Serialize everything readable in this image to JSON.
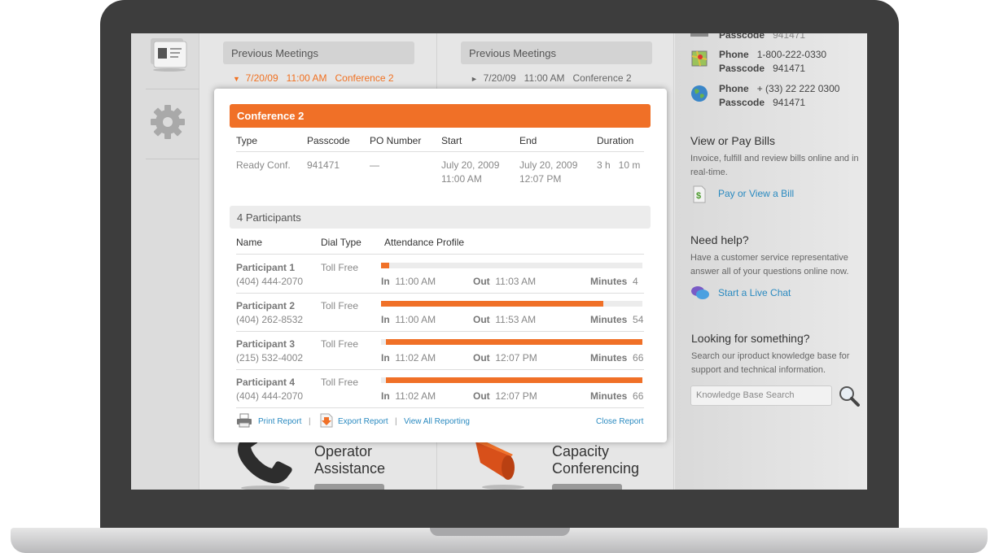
{
  "meetings": {
    "left": {
      "header": "Previous Meetings",
      "date": "7/20/09",
      "time": "11:00 AM",
      "name": "Conference 2",
      "arrow": "▼"
    },
    "right": {
      "header": "Previous Meetings",
      "date": "7/20/09",
      "time": "11:00 AM",
      "name": "Conference 2",
      "arrow": "►"
    }
  },
  "report": {
    "title": "Conference 2",
    "columns": [
      "Type",
      "Passcode",
      "PO Number",
      "Start",
      "End",
      "Duration"
    ],
    "type": "Ready Conf.",
    "passcode": "941471",
    "po_number": "—",
    "start_date": "July 20, 2009",
    "start_time": "11:00 AM",
    "end_date": "July 20, 2009",
    "end_time": "12:07 PM",
    "duration": "3 h   10 m",
    "participants_header": "4  Participants",
    "participant_columns": [
      "Name",
      "Dial Type",
      "Attendance Profile"
    ],
    "in_label": "In",
    "out_label": "Out",
    "minutes_label": "Minutes",
    "participants": [
      {
        "name": "Participant 1",
        "phone": "(404) 444-2070",
        "dial": "Toll Free",
        "in": "11:00 AM",
        "out": "11:03 AM",
        "minutes": "4",
        "bar_start": 0.0,
        "bar_end": 0.03
      },
      {
        "name": "Participant 2",
        "phone": "(404) 262-8532",
        "dial": "Toll Free",
        "in": "11:00 AM",
        "out": "11:53 AM",
        "minutes": "54",
        "bar_start": 0.0,
        "bar_end": 0.85
      },
      {
        "name": "Participant 3",
        "phone": "(215) 532-4002",
        "dial": "Toll Free",
        "in": "11:02 AM",
        "out": "12:07 PM",
        "minutes": "66",
        "bar_start": 0.02,
        "bar_end": 1.0
      },
      {
        "name": "Participant 4",
        "phone": "(404) 444-2070",
        "dial": "Toll Free",
        "in": "11:02 AM",
        "out": "12:07 PM",
        "minutes": "66",
        "bar_start": 0.02,
        "bar_end": 1.0
      }
    ],
    "footer": {
      "print": "Print Report",
      "export": "Export Report",
      "view_all": "View All Reporting",
      "close": "Close Report",
      "sep": "|"
    }
  },
  "right_pane": {
    "top_partial_label": "Passcode",
    "top_partial_value": "941471",
    "phone1_label": "Phone",
    "phone1_value": "1-800-222-0330",
    "pass1_label": "Passcode",
    "pass1_value": "941471",
    "phone2_label": "Phone",
    "phone2_value": "+ (33) 22 222 0300",
    "pass2_label": "Passcode",
    "pass2_value": "941471",
    "bills_title": "View or Pay Bills",
    "bills_text": "Invoice, fulfill and review bills online and in real-time.",
    "bills_link": "Pay or View a Bill",
    "help_title": "Need help?",
    "help_text": "Have a customer service representative answer all of your questions online now.",
    "help_link": "Start a Live Chat",
    "search_title": "Looking for something?",
    "search_text": "Search our iproduct knowledge base for support and technical information.",
    "search_placeholder": "Knowledge Base Search"
  },
  "services": {
    "operator": "Operator Assistance",
    "capacity": "Capacity Conferencing"
  },
  "colors": {
    "accent": "#f07027",
    "link": "#2a8ac0"
  }
}
